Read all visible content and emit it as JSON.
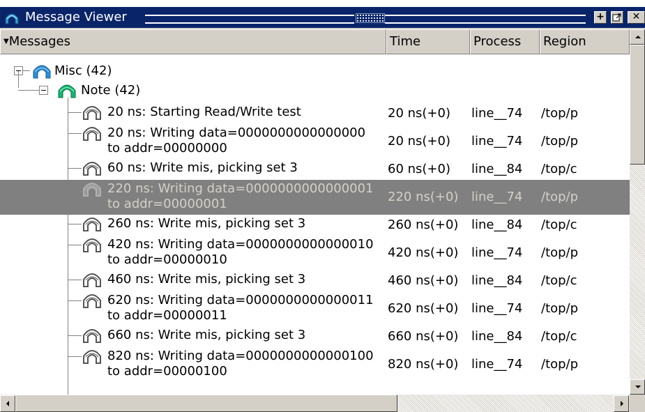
{
  "window": {
    "title": "Message Viewer",
    "icons": [
      "wave-icon",
      "grip-icon",
      "dock-icon",
      "undock-icon",
      "close-icon"
    ]
  },
  "columns": [
    "Messages",
    "Time",
    "Process",
    "Region"
  ],
  "tree": {
    "group": {
      "label": "Misc (42)",
      "icon": "wave-icon-blue"
    },
    "subgroup": {
      "label": "Note (42)",
      "icon": "wave-icon-green"
    }
  },
  "rows": [
    {
      "msg": [
        "20 ns: Starting Read/Write test"
      ],
      "time": "20 ns(+0)",
      "process": "line__74",
      "region": "/top/p",
      "selected": false
    },
    {
      "msg": [
        "20 ns: Writing data=0000000000000000",
        "to addr=00000000"
      ],
      "time": "20 ns(+0)",
      "process": "line__74",
      "region": "/top/p",
      "selected": false
    },
    {
      "msg": [
        "60 ns: Write mis, picking set 3"
      ],
      "time": "60 ns(+0)",
      "process": "line__84",
      "region": "/top/c",
      "selected": false
    },
    {
      "msg": [
        "220 ns: Writing data=0000000000000001",
        "to addr=00000001"
      ],
      "time": "220 ns(+0)",
      "process": "line__74",
      "region": "/top/p",
      "selected": true
    },
    {
      "msg": [
        "260 ns: Write mis, picking set 3"
      ],
      "time": "260 ns(+0)",
      "process": "line__84",
      "region": "/top/c",
      "selected": false
    },
    {
      "msg": [
        "420 ns: Writing data=0000000000000010",
        "to addr=00000010"
      ],
      "time": "420 ns(+0)",
      "process": "line__74",
      "region": "/top/p",
      "selected": false
    },
    {
      "msg": [
        "460 ns: Write mis, picking set 3"
      ],
      "time": "460 ns(+0)",
      "process": "line__84",
      "region": "/top/c",
      "selected": false
    },
    {
      "msg": [
        "620 ns: Writing data=0000000000000011",
        "to addr=00000011"
      ],
      "time": "620 ns(+0)",
      "process": "line__74",
      "region": "/top/p",
      "selected": false
    },
    {
      "msg": [
        "660 ns: Write mis, picking set 3"
      ],
      "time": "660 ns(+0)",
      "process": "line__84",
      "region": "/top/c",
      "selected": false
    },
    {
      "msg": [
        "820 ns: Writing data=0000000000000100",
        "to addr=00000100"
      ],
      "time": "820 ns(+0)",
      "process": "line__74",
      "region": "/top/p",
      "selected": false
    }
  ],
  "colors": {
    "titlebar": "#0a246a",
    "selection": "#808080",
    "selection_text": "#d4d0c8"
  }
}
